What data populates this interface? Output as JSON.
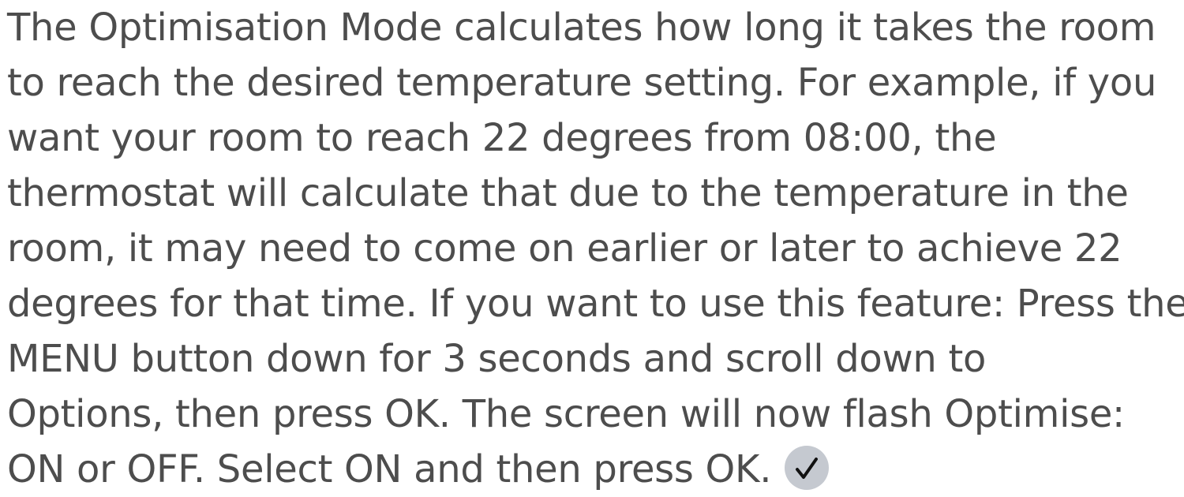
{
  "paragraph": {
    "lines": [
      "The Optimisation Mode calculates how long it takes the room",
      "to reach the desired temperature setting. For example, if you",
      "want your room to reach 22 degrees from 08:00, the",
      "thermostat will calculate that due to the temperature in the",
      "room, it may need to come on earlier or later to achieve 22",
      "degrees for that time. If you want to use this feature: Press the",
      "MENU button down for 3 seconds and scroll down to",
      "Options, then press OK. The screen will now flash Optimise:",
      "ON or OFF. Select ON and then press OK."
    ]
  },
  "badge": {
    "icon": "checkmark-icon",
    "background_color": "#c5c9d0",
    "check_color": "#111111"
  }
}
